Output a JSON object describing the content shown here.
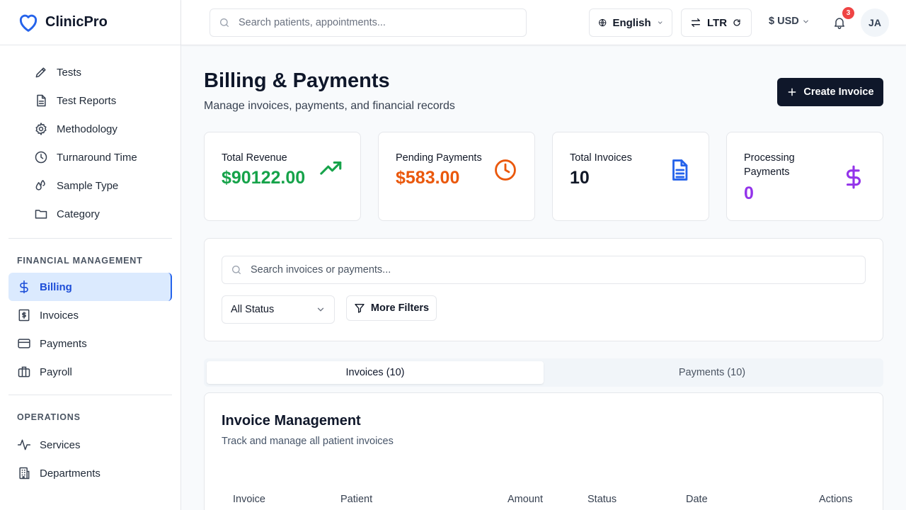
{
  "brand": {
    "name": "ClinicPro",
    "accent": "#2563eb"
  },
  "sidebar": {
    "lab_items": [
      {
        "label": "Tests",
        "icon": "pencil-icon"
      },
      {
        "label": "Test Reports",
        "icon": "document-icon"
      },
      {
        "label": "Methodology",
        "icon": "gear-icon"
      },
      {
        "label": "Turnaround Time",
        "icon": "clock-icon"
      },
      {
        "label": "Sample Type",
        "icon": "droplets-icon"
      },
      {
        "label": "Category",
        "icon": "folder-icon"
      }
    ],
    "financial": {
      "title": "FINANCIAL MANAGEMENT",
      "items": [
        {
          "label": "Billing",
          "icon": "dollar-icon",
          "active": true
        },
        {
          "label": "Invoices",
          "icon": "receipt-icon"
        },
        {
          "label": "Payments",
          "icon": "credit-card-icon"
        },
        {
          "label": "Payroll",
          "icon": "briefcase-icon"
        }
      ]
    },
    "operations": {
      "title": "OPERATIONS",
      "items": [
        {
          "label": "Services",
          "icon": "activity-icon"
        },
        {
          "label": "Departments",
          "icon": "building-icon"
        }
      ]
    }
  },
  "header": {
    "search_placeholder": "Search patients, appointments...",
    "language": "English",
    "direction": "LTR",
    "currency": "$ USD",
    "notification_count": "3",
    "avatar_initials": "JA"
  },
  "main": {
    "title": "Billing & Payments",
    "subtitle": "Manage invoices, payments, and financial records",
    "create_label": "Create Invoice",
    "stats": [
      {
        "label": "Total Revenue",
        "value": "$90122.00",
        "color": "#16a34a",
        "icon": "trending-up-icon"
      },
      {
        "label": "Pending Payments",
        "value": "$583.00",
        "color": "#ea580c",
        "icon": "clock-icon"
      },
      {
        "label": "Total Invoices",
        "value": "10",
        "color": "#111827",
        "icon": "file-text-icon"
      },
      {
        "label": "Processing Payments",
        "value": "0",
        "color": "#9333ea",
        "icon": "dollar-icon"
      }
    ],
    "filters": {
      "search_placeholder": "Search invoices or payments...",
      "status_selected": "All Status",
      "more_filters_label": "More Filters"
    },
    "tabs": [
      {
        "label": "Invoices (10)",
        "active": true
      },
      {
        "label": "Payments (10)",
        "active": false
      }
    ],
    "invoice_section": {
      "title": "Invoice Management",
      "subtitle": "Track and manage all patient invoices",
      "columns": [
        "Invoice",
        "Patient",
        "Amount",
        "Status",
        "Date",
        "Actions"
      ]
    }
  }
}
